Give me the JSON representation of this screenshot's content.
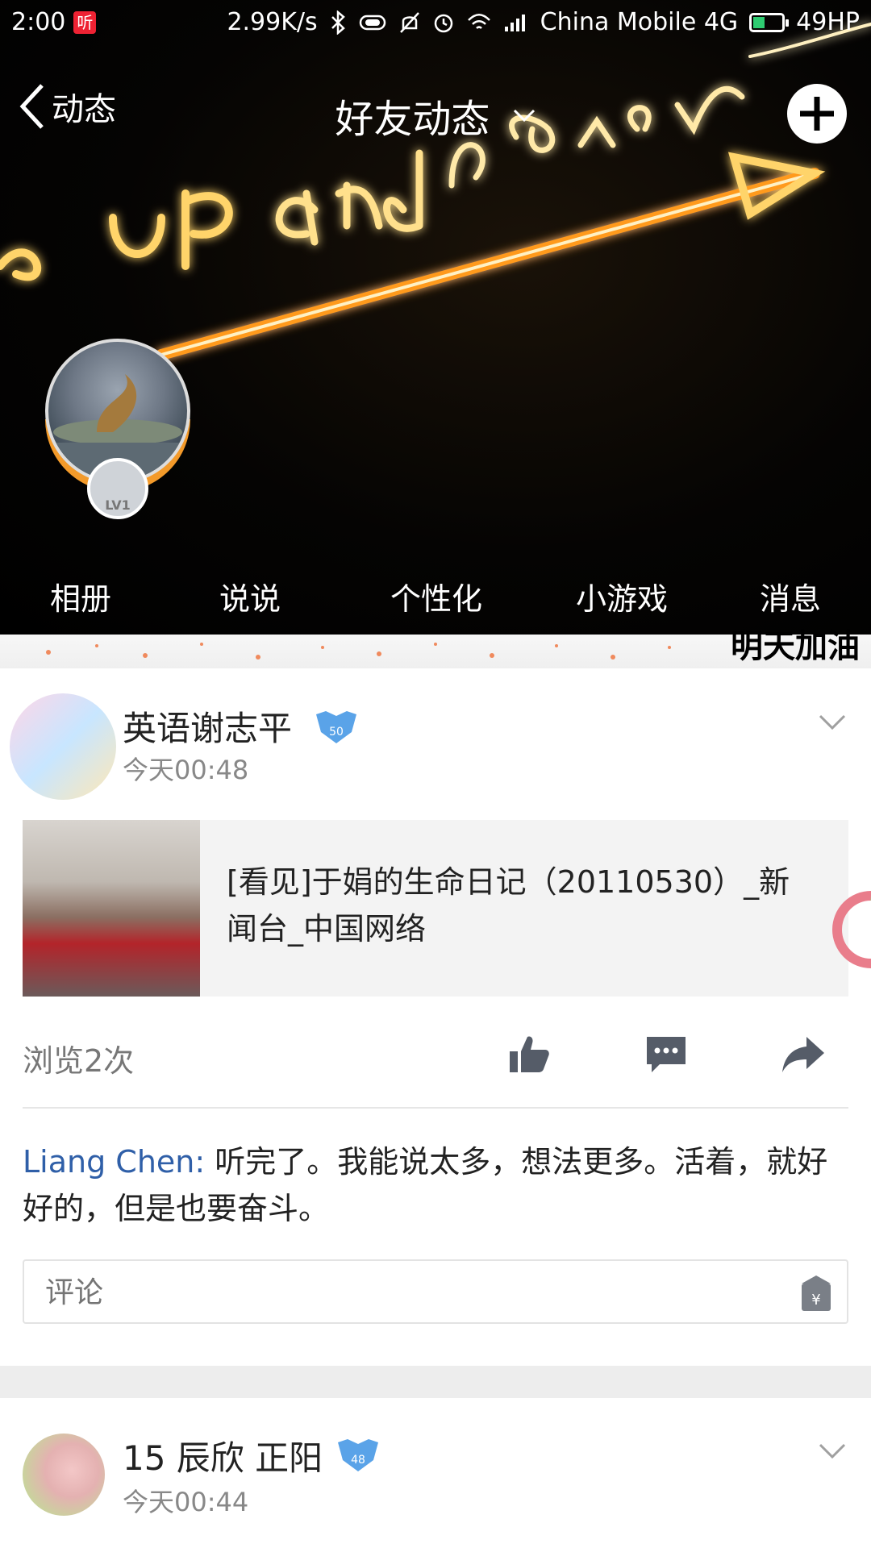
{
  "status_bar": {
    "time": "2:00",
    "listen_badge": "听",
    "network_speed": "2.99K/s",
    "carrier": "China Mobile 4G",
    "battery_text": "49HP",
    "battery_level": 0.49,
    "icons": [
      "bluetooth-icon",
      "vibrate-icon",
      "mute-bell-icon",
      "alarm-icon",
      "wifi-icon",
      "signal-icon"
    ]
  },
  "nav": {
    "back_label": "动态",
    "title": "好友动态",
    "add_icon": "plus-icon"
  },
  "profile": {
    "level": "LV1"
  },
  "profile_tabs": [
    "相册",
    "说说",
    "个性化",
    "小游戏",
    "消息"
  ],
  "banner": {
    "text": "明天加油"
  },
  "posts": [
    {
      "author": "英语谢志平",
      "vip_level": "50",
      "time": "今天00:48",
      "link_title": "[看见]于娟的生命日记（20110530）_新闻台_中国网络",
      "views": "浏览2次",
      "comment": {
        "author": "Liang Chen",
        "separator": ": ",
        "text": "听完了。我能说太多，想法更多。活着，就好好的，但是也要奋斗。"
      },
      "comment_placeholder": "评论"
    },
    {
      "author": "15 辰欣 正阳",
      "vip_level": "48",
      "time": "今天00:44"
    }
  ],
  "colors": {
    "link_blue": "#2f5fa8",
    "neon_orange": "#f7a21b",
    "ring_orange": "#f39a2a",
    "action_gray": "#555c68"
  }
}
